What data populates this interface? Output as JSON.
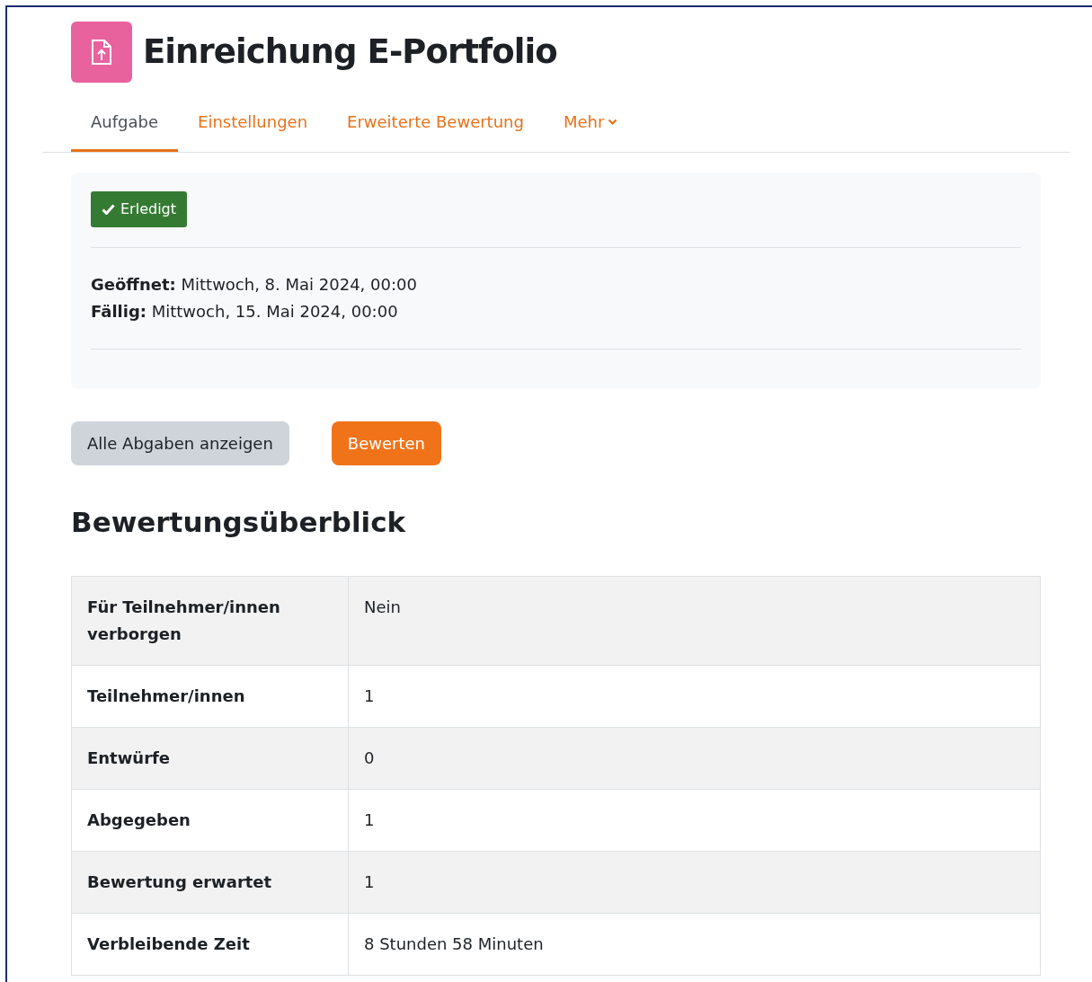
{
  "title": "Einreichung E-Portfolio",
  "tabs": [
    {
      "label": "Aufgabe",
      "selected": true,
      "kind": "link"
    },
    {
      "label": "Einstellungen",
      "selected": false,
      "kind": "link"
    },
    {
      "label": "Erweiterte Bewertung",
      "selected": false,
      "kind": "link"
    },
    {
      "label": "Mehr",
      "selected": false,
      "kind": "dropdown"
    }
  ],
  "completion_badge": "Erledigt",
  "dates": [
    "**Geöffnet:** Mittwoch, 8. Mai 2024, 00:00",
    "**Fällig:** Mittwoch, 15. Mai 2024, 00:00"
  ],
  "buttons": [
    {
      "label": "Alle Abgaben anzeigen",
      "kind": "secondary"
    },
    {
      "label": "Bewerten",
      "kind": "primary"
    }
  ],
  "section_heading": "Bewertungsüberblick",
  "table": {
    "rows": [
      {
        "label": "Für Teilnehmer/innen verborgen",
        "value": "Nein"
      },
      {
        "label": "Teilnehmer/innen",
        "value": "1"
      },
      {
        "label": "Entwürfe",
        "value": "0"
      },
      {
        "label": "Abgegeben",
        "value": "1"
      },
      {
        "label": "Bewertung erwartet",
        "value": "1"
      },
      {
        "label": "Verbleibende Zeit",
        "value": "8 Stunden 58 Minuten"
      }
    ]
  }
}
